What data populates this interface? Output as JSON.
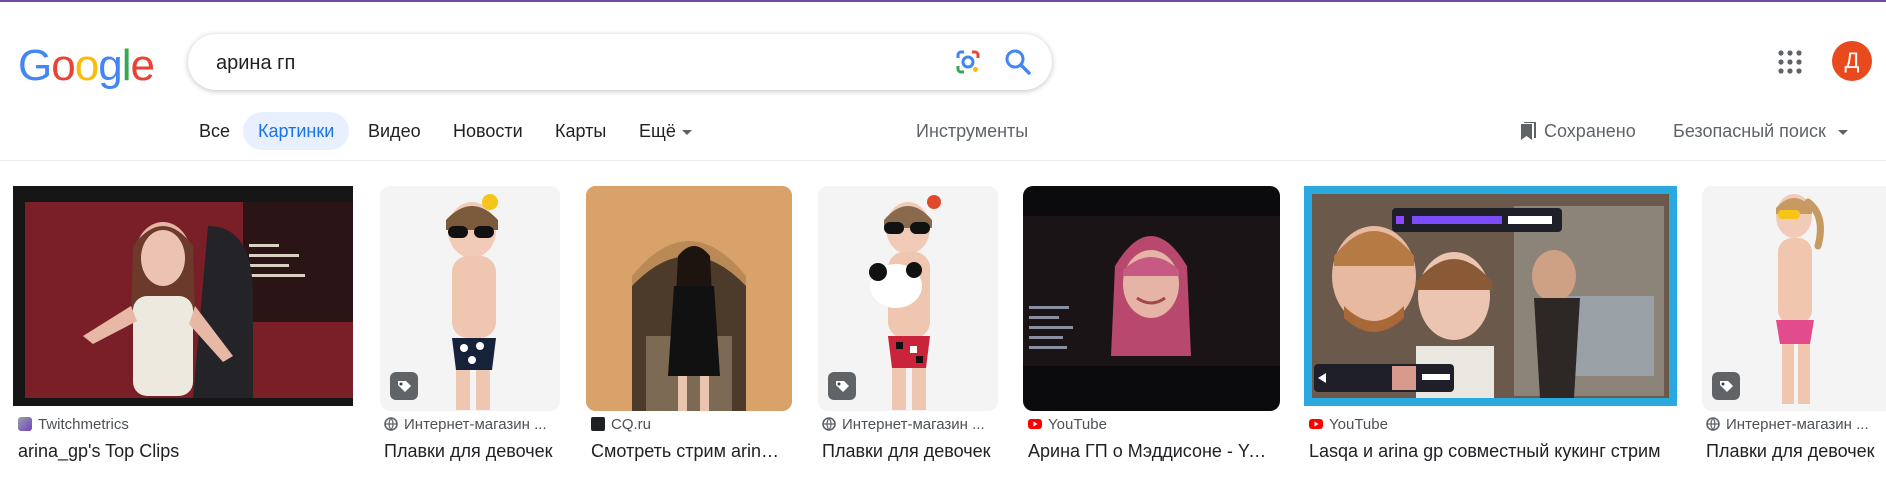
{
  "logo": {
    "letters": [
      "G",
      "o",
      "o",
      "g",
      "l",
      "e"
    ],
    "colors": [
      "#4285f4",
      "#ea4335",
      "#fbbc05",
      "#4285f4",
      "#34a853",
      "#ea4335"
    ]
  },
  "search": {
    "value": "арина гп"
  },
  "user": {
    "initial": "Д",
    "color": "#e8491d"
  },
  "tabs": [
    {
      "label": "Все"
    },
    {
      "label": "Картинки",
      "active": true
    },
    {
      "label": "Видео"
    },
    {
      "label": "Новости"
    },
    {
      "label": "Карты"
    },
    {
      "label": "Ещё"
    }
  ],
  "toolbar": {
    "tools": "Инструменты",
    "saved": "Сохранено",
    "safe_search": "Безопасный поиск"
  },
  "results": [
    {
      "source": "Twitchmetrics",
      "title": "arina_gp's Top Clips",
      "icon": "twitchmetrics-icon"
    },
    {
      "source": "Интернет-магазин ...",
      "title": "Плавки для девочек",
      "icon": "globe-icon",
      "product": true
    },
    {
      "source": "CQ.ru",
      "title": "Смотреть стрим arina_gp",
      "icon": "cq-icon"
    },
    {
      "source": "Интернет-магазин ...",
      "title": "Плавки для девочек",
      "icon": "globe-icon",
      "product": true
    },
    {
      "source": "YouTube",
      "title": "Арина ГП о Мэддисоне - YouTube",
      "icon": "youtube-icon"
    },
    {
      "source": "YouTube",
      "title": "Lasqa и arina gp совместный кукинг стрим",
      "icon": "youtube-icon"
    },
    {
      "source": "Интернет-магазин ...",
      "title": "Плавки для девочек",
      "icon": "globe-icon",
      "product": true
    }
  ]
}
